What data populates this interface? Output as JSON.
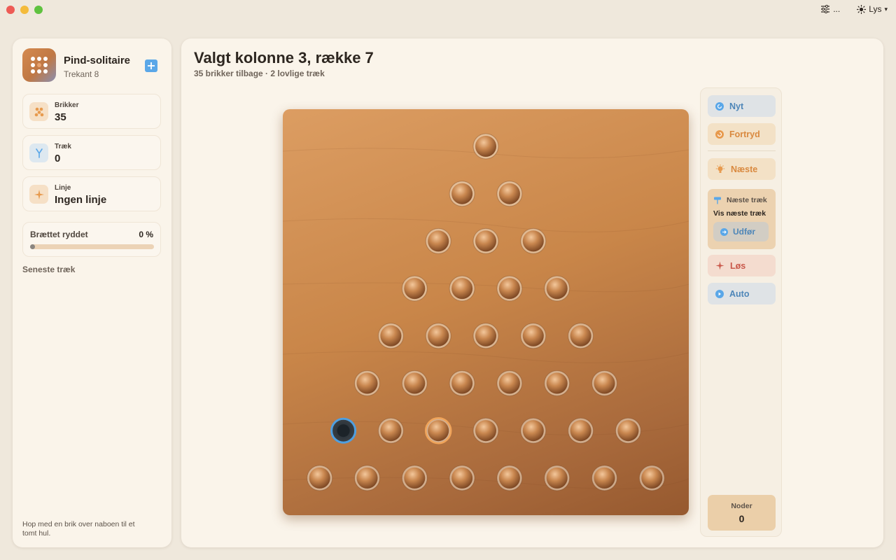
{
  "toolbar": {
    "settings_icon": "sliders-icon",
    "more_label": "...",
    "theme_label": "Lys",
    "theme_icon": "sun-icon"
  },
  "sidebar": {
    "app_title": "Pind-solitaire",
    "app_subtitle": "Trekant 8",
    "stats": [
      {
        "label": "Brikker",
        "value": "35",
        "icon": "pegs-icon",
        "color": "#e79a4e"
      },
      {
        "label": "Træk",
        "value": "0",
        "icon": "fork-icon",
        "color": "#5aa7e8"
      },
      {
        "label": "Linje",
        "value": "Ingen linje",
        "icon": "sparkle-icon",
        "color": "#e79a4e"
      }
    ],
    "progress": {
      "label": "Brættet ryddet",
      "percent_label": "0 %",
      "value": 0
    },
    "recent_label": "Seneste træk",
    "hint": "Hop med en brik over naboen til et tomt hul."
  },
  "main": {
    "title": "Valgt kolonne 3, række 7",
    "subtitle": "35 brikker tilbage · 2 lovlige træk"
  },
  "board": {
    "rows": 8,
    "empty": [
      [
        7,
        1
      ]
    ],
    "selected": [
      7,
      3
    ]
  },
  "panel": {
    "buttons": [
      {
        "label": "Nyt",
        "icon": "refresh-icon",
        "color": "#4e86b8",
        "bg": "#dfe3e6"
      },
      {
        "label": "Fortryd",
        "icon": "undo-icon",
        "color": "#d9893f",
        "bg": "#f3e1c6"
      },
      {
        "label": "Næste",
        "icon": "bulb-icon",
        "color": "#d9893f",
        "bg": "#f3e1c6"
      },
      {
        "label": "Løs",
        "icon": "sparkle-icon",
        "color": "#c9584a",
        "bg": "#f4dccf"
      },
      {
        "label": "Auto",
        "icon": "play-icon",
        "color": "#4e86b8",
        "bg": "#dfe3e6"
      }
    ],
    "hint_title": "Næste træk",
    "hint_text": "Vis næste træk",
    "hint_action": "Udfør",
    "nodes_label": "Noder",
    "nodes_value": "0"
  }
}
